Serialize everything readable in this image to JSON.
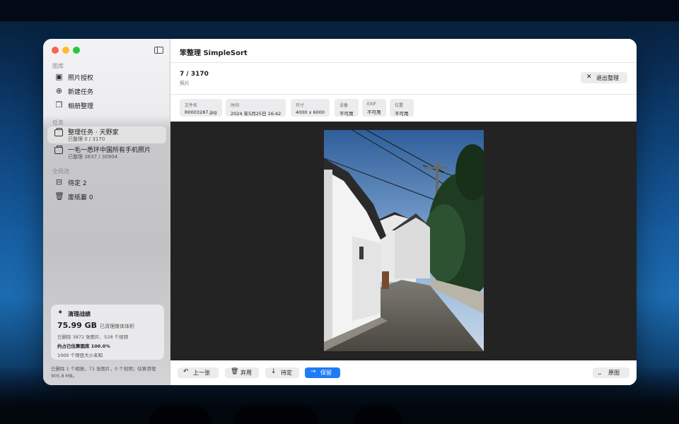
{
  "app": {
    "title": "笨整理 SimpleSort"
  },
  "sidebar": {
    "library_label": "图库",
    "library_items": [
      {
        "label": "照片授权",
        "icon": "photo-stack-icon"
      },
      {
        "label": "新建任务",
        "icon": "plus-circle-icon"
      },
      {
        "label": "相册整理",
        "icon": "albums-icon"
      }
    ],
    "tasks_label": "任务",
    "tasks": [
      {
        "title": "整理任务 · 天野家",
        "progress": "已整理 0 / 3170",
        "active": true
      },
      {
        "title": "一毛一悉环中国所有手机照片",
        "progress": "已整理 3837 / 30904",
        "active": false
      }
    ],
    "global_label": "全局池",
    "global_items": [
      {
        "label": "待定 2",
        "icon": "tray-icon"
      },
      {
        "label": "废纸篓 0",
        "icon": "trash-icon"
      }
    ],
    "stats": {
      "title": "清理战绩",
      "amount": "75.99 GB",
      "amount_note": "已清理媒体体积",
      "deleted": "已删除 3872 张图片、528 个视频",
      "share": "约占已估算图库 100.0%",
      "unknown": "1000 个项目大小未知"
    },
    "footer_note": "已删除 1 个相册，71 张图片，0 个视频；估算清理 905.8 MB。"
  },
  "main": {
    "counter": "7 / 3170",
    "counter_sub": "照片",
    "exit_button": "退出整理",
    "meta": [
      {
        "key": "文件名",
        "value": "R0003287.jpg"
      },
      {
        "key": "时间",
        "value": "2024 年5月25日 16:42"
      },
      {
        "key": "尺寸",
        "value": "4000 x 6000"
      },
      {
        "key": "设备",
        "value": "不可用"
      },
      {
        "key": "EXIF",
        "value": "不可用"
      },
      {
        "key": "位置",
        "value": "不可用"
      }
    ],
    "buttons": {
      "prev": "上一张",
      "discard": "弃用",
      "pending": "待定",
      "keep": "保留",
      "original": "原图"
    }
  },
  "colors": {
    "accent": "#1f7cf6",
    "sidebar_bg": "#c6c6c8",
    "viewer_bg": "#232323",
    "traffic_close": "#ff5f57",
    "traffic_min": "#febc2e",
    "traffic_max": "#28c840"
  }
}
